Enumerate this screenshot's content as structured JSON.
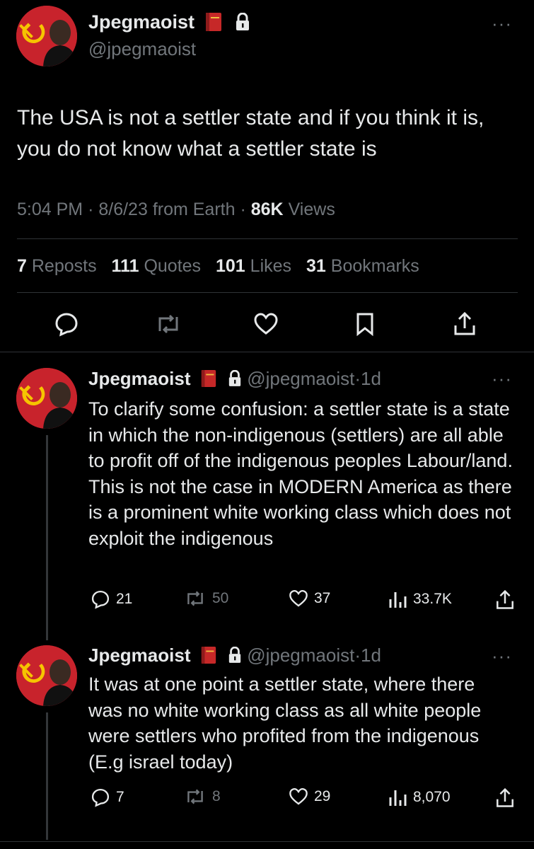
{
  "main_tweet": {
    "display_name": "Jpegmaoist",
    "handle": "@jpegmaoist",
    "text": "The USA is not a settler state and if you think it is, you do not know what a settler state is",
    "time": "5:04 PM",
    "date": "8/6/23",
    "source": "from Earth",
    "views_count": "86K",
    "views_label": "Views",
    "separator": "·",
    "stats": [
      {
        "count": "7",
        "label": "Reposts"
      },
      {
        "count": "111",
        "label": "Quotes"
      },
      {
        "count": "101",
        "label": "Likes"
      },
      {
        "count": "31",
        "label": "Bookmarks"
      }
    ],
    "more": "···"
  },
  "replies": [
    {
      "display_name": "Jpegmaoist",
      "handle": "@jpegmaoist",
      "age": "1d",
      "text": "To clarify some confusion: a settler state is a state in which the non-indigenous (settlers) are all able to profit off of the indigenous peoples Labour/land. This is not the case in MODERN America as there is a prominent white working class which does not exploit the indigenous",
      "replies": "21",
      "reposts": "50",
      "likes": "37",
      "views": "33.7K"
    },
    {
      "display_name": "Jpegmaoist",
      "handle": "@jpegmaoist",
      "age": "1d",
      "text": "It was at one point a settler state, where there was no white working class as all white people were settlers who profited from the indigenous (E.g israel today)",
      "replies": "7",
      "reposts": "8",
      "likes": "29",
      "views": "8,070"
    }
  ],
  "colors": {
    "background": "#000000",
    "text": "#e7e9ea",
    "muted": "#71767b",
    "divider": "#2f3336",
    "avatar_red": "#c8232c",
    "book_red": "#c62828"
  },
  "icons": [
    "hammer-sickle-icon",
    "red-book-icon",
    "lock-icon",
    "more-icon",
    "reply-icon",
    "repost-icon",
    "like-icon",
    "bookmark-icon",
    "share-icon",
    "views-icon"
  ]
}
